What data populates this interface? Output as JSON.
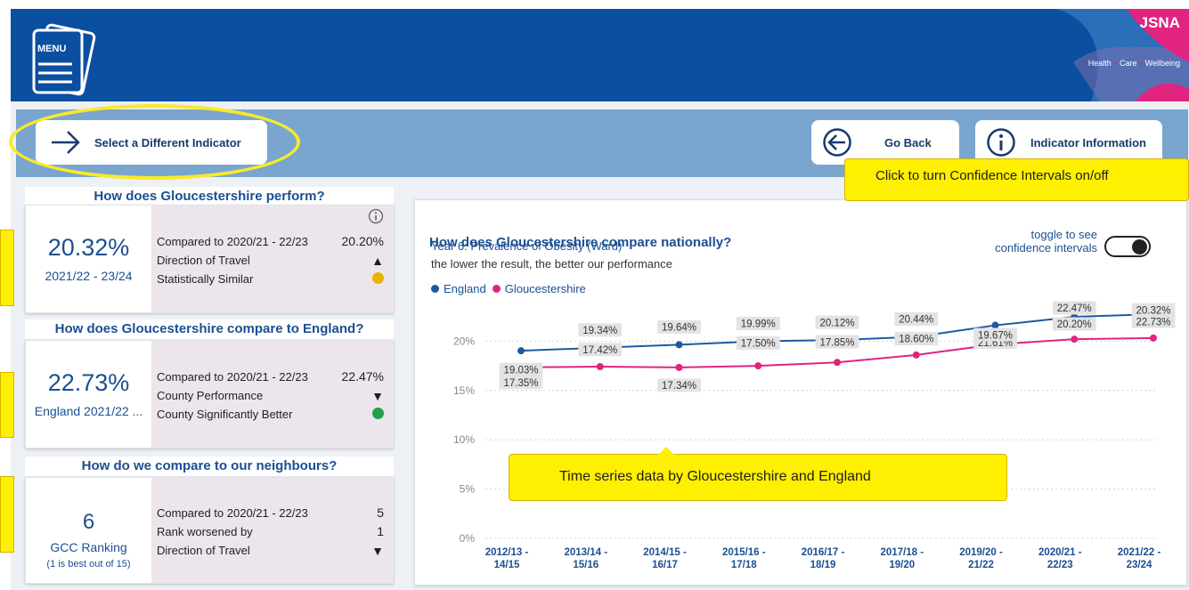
{
  "header": {
    "menu_label": "MENU",
    "brand_title": "JSNA",
    "brand_sub": [
      "Health",
      "Care",
      "Wellbeing"
    ]
  },
  "nav": {
    "select_label": "Select a Different Indicator",
    "goback_label": "Go Back",
    "info_label": "Indicator Information"
  },
  "tooltips": {
    "confidence": "Click to turn Confidence Intervals on/off",
    "timeseries": "Time series data by Gloucestershire and England"
  },
  "perform": {
    "title": "How does Gloucestershire perform?",
    "value": "20.32%",
    "period": "2021/22 - 23/24",
    "rows": [
      {
        "label": "Compared to 2020/21 - 22/23",
        "value": "20.20%"
      },
      {
        "label": "Direction of Travel",
        "indicator": "▲"
      },
      {
        "label": "Statistically Similar",
        "indicator": "amber"
      }
    ]
  },
  "england": {
    "title": "How does Gloucestershire compare to England?",
    "value": "22.73%",
    "period": "England 2021/22 ...",
    "rows": [
      {
        "label": "Compared to 2020/21 - 22/23",
        "value": "22.47%"
      },
      {
        "label": "County Performance",
        "indicator": "▼"
      },
      {
        "label": "County Significantly Better",
        "indicator": "green"
      }
    ]
  },
  "neighbours": {
    "title": "How do we compare to our neighbours?",
    "value": "6",
    "label": "GCC Ranking",
    "note": "(1 is best out of 15)",
    "rows": [
      {
        "label": "Compared to 2020/21 - 22/23",
        "value": "5"
      },
      {
        "label": "Rank worsened by",
        "value": "1"
      },
      {
        "label": "Direction of Travel",
        "indicator": "▼"
      }
    ]
  },
  "chart_panel": {
    "title": "How does Gloucestershire compare nationally?",
    "subtitle": "Year 6: Prevalence of Obesity (Ward)",
    "note": "the lower the result, the better our performance",
    "toggle_label_1": "toggle to see",
    "toggle_label_2": "confidence intervals",
    "legend": [
      {
        "name": "England",
        "color": "#1b5aa0"
      },
      {
        "name": "Gloucestershire",
        "color": "#e0247f"
      }
    ]
  },
  "chart_data": {
    "type": "line",
    "categories": [
      [
        "2012/13 -",
        "14/15"
      ],
      [
        "2013/14 -",
        "15/16"
      ],
      [
        "2014/15 -",
        "16/17"
      ],
      [
        "2015/16 -",
        "17/18"
      ],
      [
        "2016/17 -",
        "18/19"
      ],
      [
        "2017/18 -",
        "19/20"
      ],
      [
        "2019/20 -",
        "21/22"
      ],
      [
        "2020/21 -",
        "22/23"
      ],
      [
        "2021/22 -",
        "23/24"
      ]
    ],
    "series": [
      {
        "name": "England",
        "color": "#1b5aa0",
        "values": [
          19.03,
          19.34,
          19.64,
          19.99,
          20.12,
          20.44,
          21.61,
          22.47,
          22.73
        ],
        "labels": [
          "19.03%",
          "19.34%",
          "19.64%",
          "19.99%",
          "20.12%",
          "20.44%",
          "21.61%",
          "22.47%",
          "22.73%"
        ]
      },
      {
        "name": "Gloucestershire",
        "color": "#e0247f",
        "values": [
          17.35,
          17.42,
          17.34,
          17.5,
          17.85,
          18.6,
          19.67,
          20.2,
          20.32
        ],
        "labels": [
          "17.35%",
          "17.42%",
          "17.34%",
          "17.50%",
          "17.85%",
          "18.60%",
          "19.67%",
          "20.20%",
          "20.32%"
        ]
      }
    ],
    "yticks": [
      "0%",
      "5%",
      "10%",
      "15%",
      "20%"
    ],
    "ylim": [
      0,
      25
    ],
    "grid": true
  }
}
